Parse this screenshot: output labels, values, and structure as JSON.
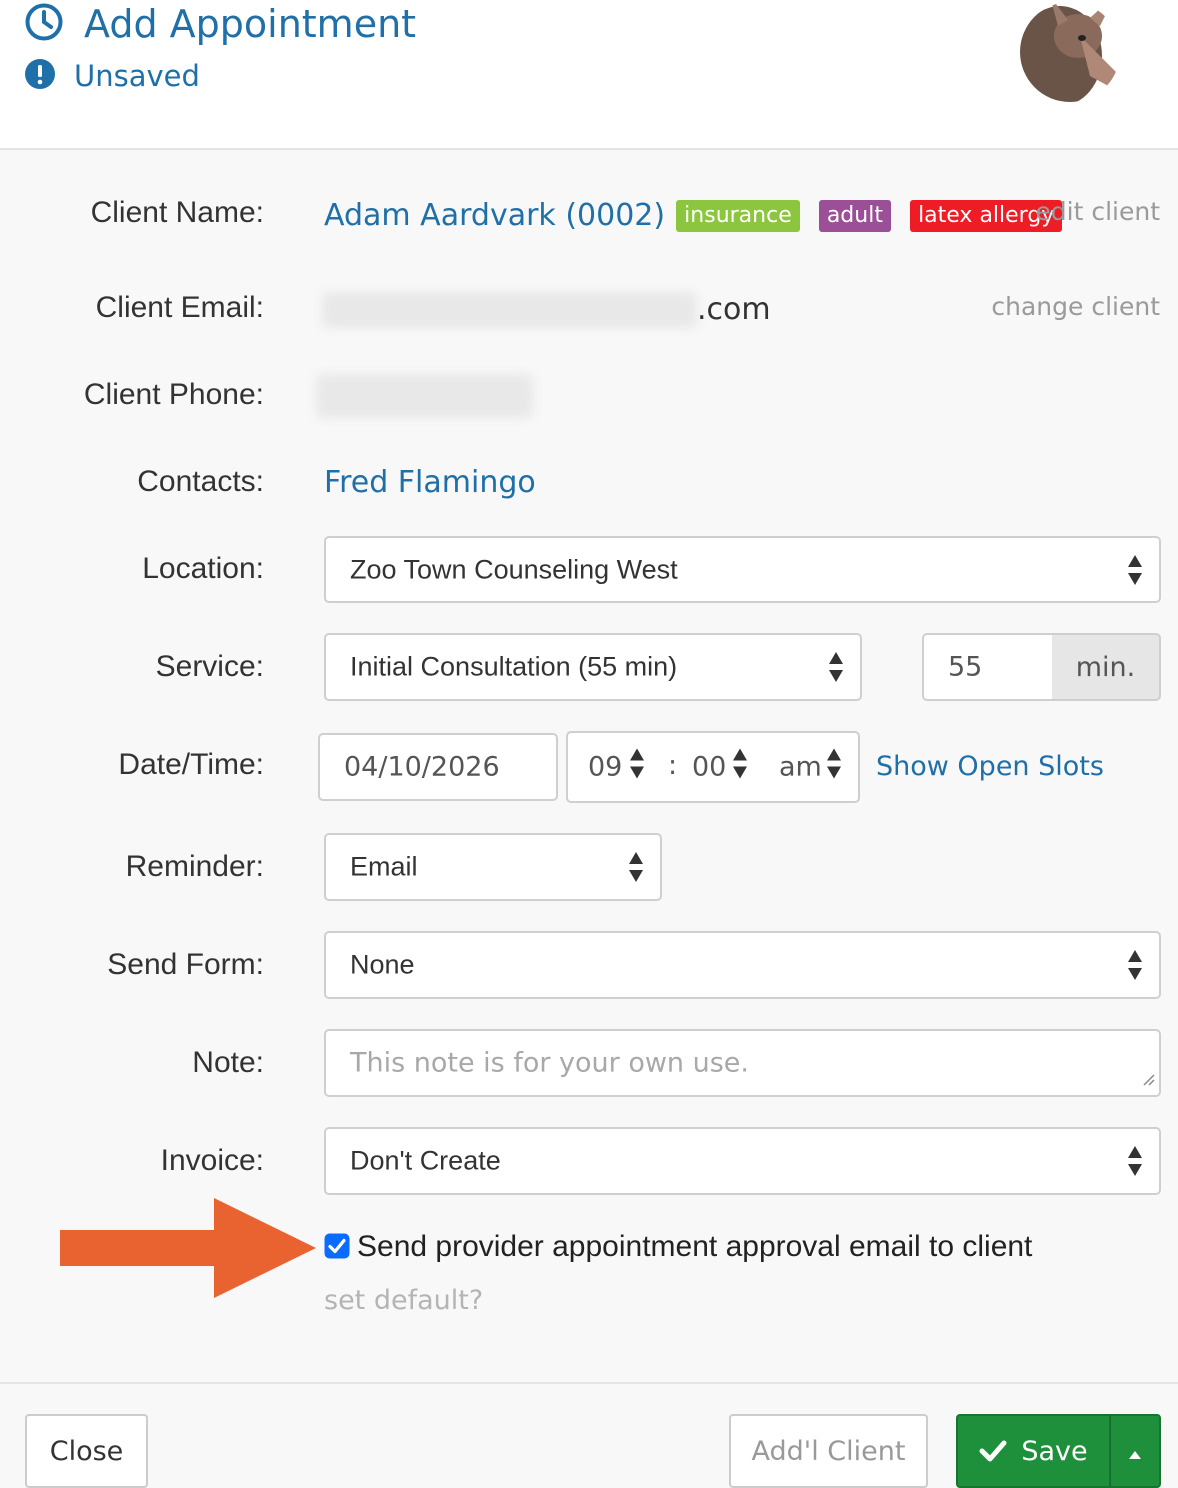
{
  "header": {
    "title": "Add Appointment",
    "status": "Unsaved",
    "title_icon": "clock-icon",
    "status_icon": "exclamation-circle-icon",
    "avatar_icon": "aardvark-avatar"
  },
  "client": {
    "name_label": "Client Name:",
    "name": "Adam Aardvark (0002)",
    "tags": [
      {
        "label": "insurance",
        "color": "#8cc63f"
      },
      {
        "label": "adult",
        "color": "#9b4f96"
      },
      {
        "label": "latex allergy",
        "color": "#ee1c25"
      }
    ],
    "edit_link": "edit client",
    "email_label": "Client Email:",
    "email_suffix": ".com",
    "change_link": "change client",
    "phone_label": "Client Phone:"
  },
  "contacts": {
    "label": "Contacts:",
    "value": "Fred Flamingo"
  },
  "location": {
    "label": "Location:",
    "value": "Zoo Town Counseling West"
  },
  "service": {
    "label": "Service:",
    "value": "Initial Consultation (55 min)",
    "duration": "55",
    "unit": "min."
  },
  "datetime": {
    "label": "Date/Time:",
    "date": "04/10/2026",
    "hour": "09",
    "separator": ":",
    "minute": "00",
    "ampm": "am",
    "open_slots_link": "Show Open Slots"
  },
  "reminder": {
    "label": "Reminder:",
    "value": "Email"
  },
  "send_form": {
    "label": "Send Form:",
    "value": "None"
  },
  "note": {
    "label": "Note:",
    "placeholder": "This note is for your own use."
  },
  "invoice": {
    "label": "Invoice:",
    "value": "Don't Create"
  },
  "approval": {
    "checked": true,
    "label": "Send provider appointment approval email to client",
    "default_link": "set default?"
  },
  "footer": {
    "close": "Close",
    "addl_client": "Add'l Client",
    "save": "Save"
  },
  "colors": {
    "link": "#1f6fa8",
    "save_green": "#1e8f3b",
    "arrow_orange": "#e8632f"
  }
}
